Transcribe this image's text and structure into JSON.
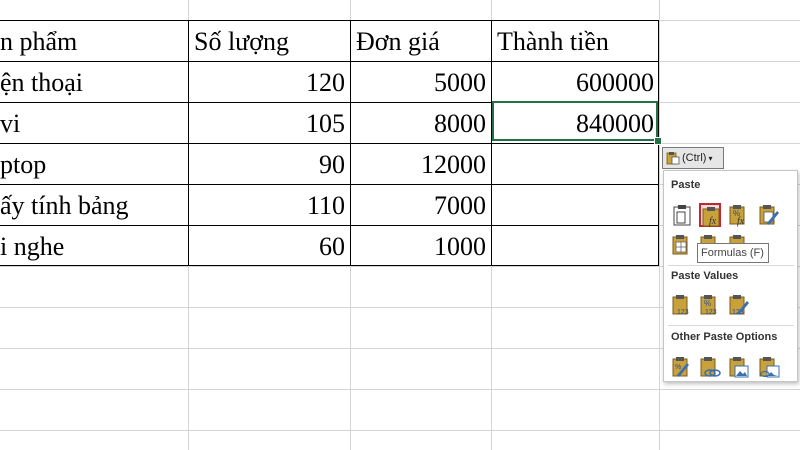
{
  "table": {
    "headers": [
      "n phẩm",
      "Số lượng",
      "Đơn giá",
      "Thành tiền"
    ],
    "rows": [
      {
        "name": "ện thoại",
        "qty": "120",
        "price": "5000",
        "total": "600000"
      },
      {
        "name": "vi",
        "qty": "105",
        "price": "8000",
        "total": "840000"
      },
      {
        "name": "ptop",
        "qty": "90",
        "price": "12000",
        "total": ""
      },
      {
        "name": "ấy tính bảng",
        "qty": "110",
        "price": "7000",
        "total": ""
      },
      {
        "name": "i nghe",
        "qty": "60",
        "price": "1000",
        "total": ""
      }
    ]
  },
  "paste_options": {
    "button_label": "(Ctrl)",
    "paste_header": "Paste",
    "paste_values_header": "Paste Values",
    "other_header": "Other Paste Options",
    "tooltip": "Formulas (F)"
  },
  "colors": {
    "selection_border": "#217346",
    "highlight_border": "#c0282f",
    "clipboard_gold": "#c9a13b",
    "icon_blue": "#3a6fb0"
  }
}
